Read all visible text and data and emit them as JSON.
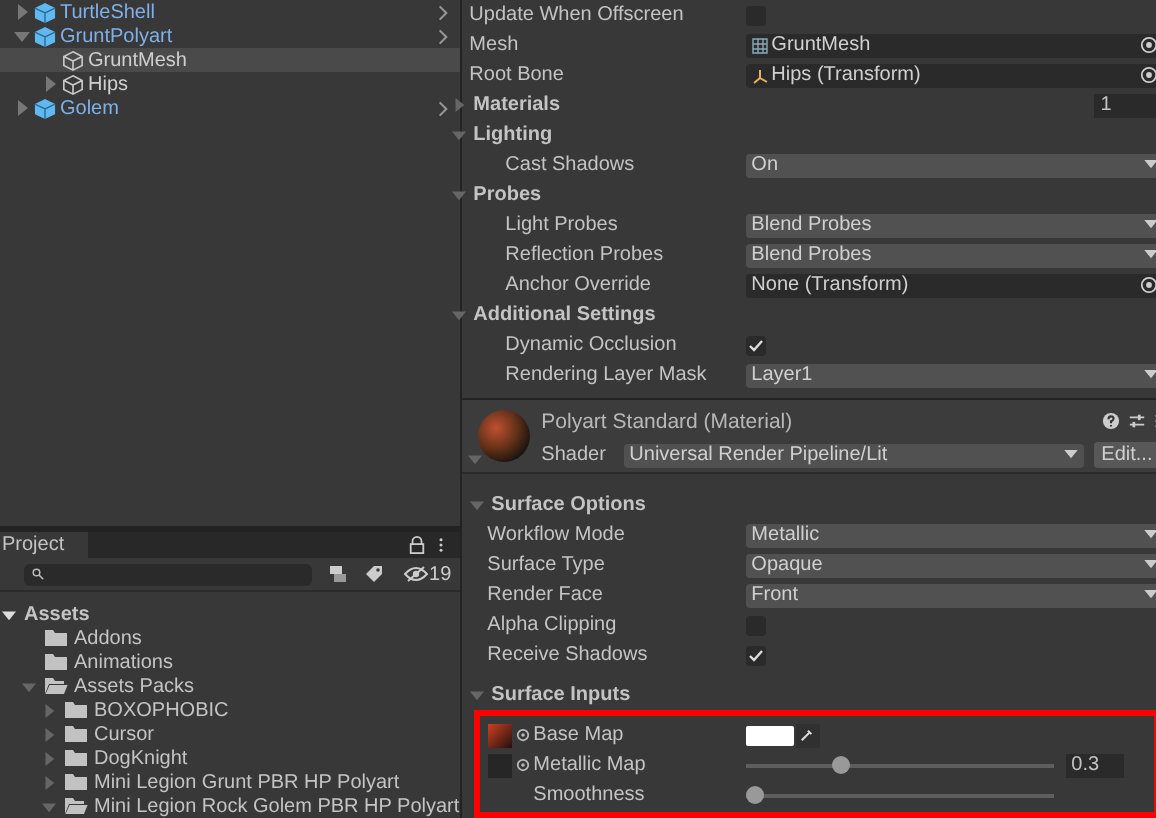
{
  "hierarchy": {
    "items": [
      {
        "label": "TurtleShell",
        "kind": "prefab",
        "expanded": false,
        "selected": false
      },
      {
        "label": "GruntPolyart",
        "kind": "prefab",
        "expanded": true,
        "selected": false,
        "children": [
          {
            "label": "GruntMesh",
            "kind": "object",
            "selected": true
          },
          {
            "label": "Hips",
            "kind": "object",
            "expanded": false,
            "selected": false
          }
        ]
      },
      {
        "label": "Golem",
        "kind": "prefab",
        "expanded": false,
        "selected": false
      }
    ]
  },
  "project": {
    "tab": "Project",
    "hidden_count": "19",
    "items": [
      {
        "label": "Assets",
        "kind": "root",
        "expanded": true,
        "children": [
          {
            "label": "Addons",
            "kind": "folder"
          },
          {
            "label": "Animations",
            "kind": "folder"
          },
          {
            "label": "Assets Packs",
            "kind": "folder",
            "expanded": true,
            "children": [
              {
                "label": "BOXOPHOBIC",
                "kind": "folder",
                "expanded": false
              },
              {
                "label": "Cursor",
                "kind": "folder",
                "expanded": false
              },
              {
                "label": "DogKnight",
                "kind": "folder",
                "expanded": false
              },
              {
                "label": "Mini Legion Grunt PBR HP Polyart",
                "kind": "folder",
                "expanded": false
              },
              {
                "label": "Mini Legion Rock Golem PBR HP Polyart",
                "kind": "folder",
                "expanded": true
              }
            ]
          }
        ]
      }
    ]
  },
  "renderer": {
    "rows": [
      {
        "label": "Update When Offscreen",
        "kind": "checkbox",
        "checked": false
      },
      {
        "label": "Mesh",
        "kind": "mesh",
        "value": "GruntMesh"
      },
      {
        "label": "Root Bone",
        "kind": "bone",
        "value": "Hips (Transform)"
      },
      {
        "label": "Materials",
        "kind": "section",
        "expanded": false,
        "value": "1"
      },
      {
        "label": "Lighting",
        "kind": "section",
        "expanded": true,
        "children": [
          {
            "label": "Cast Shadows",
            "kind": "dropdown",
            "value": "On"
          }
        ]
      },
      {
        "label": "Probes",
        "kind": "section",
        "expanded": true,
        "children": [
          {
            "label": "Light Probes",
            "kind": "dropdown",
            "value": "Blend Probes"
          },
          {
            "label": "Reflection Probes",
            "kind": "dropdown",
            "value": "Blend Probes"
          },
          {
            "label": "Anchor Override",
            "kind": "object",
            "value": "None (Transform)"
          }
        ]
      },
      {
        "label": "Additional Settings",
        "kind": "section",
        "expanded": true,
        "children": [
          {
            "label": "Dynamic Occlusion",
            "kind": "checkbox",
            "checked": true
          },
          {
            "label": "Rendering Layer Mask",
            "kind": "dropdown",
            "value": "Layer1"
          }
        ]
      }
    ]
  },
  "material": {
    "title": "Polyart Standard (Material)",
    "shader_label": "Shader",
    "shader": "Universal Render Pipeline/Lit",
    "edit_button": "Edit...",
    "expanded": true,
    "rows": [
      {
        "label": "Surface Options",
        "kind": "section",
        "expanded": true,
        "children": [
          {
            "label": "Workflow Mode",
            "kind": "dropdown",
            "value": "Metallic"
          },
          {
            "label": "Surface Type",
            "kind": "dropdown",
            "value": "Opaque"
          },
          {
            "label": "Render Face",
            "kind": "dropdown",
            "value": "Front"
          },
          {
            "label": "Alpha Clipping",
            "kind": "checkbox",
            "checked": false
          },
          {
            "label": "Receive Shadows",
            "kind": "checkbox",
            "checked": true
          }
        ]
      },
      {
        "label": "Surface Inputs",
        "kind": "section",
        "expanded": true,
        "children": [
          {
            "label": "Base Map",
            "kind": "texture"
          },
          {
            "label": "Metallic Map",
            "kind": "slider",
            "texture_slot": true,
            "level": 0.3,
            "value": "0.3"
          },
          {
            "label": "Smoothness",
            "kind": "slider",
            "texture_slot": false,
            "level": 0
          }
        ]
      }
    ]
  }
}
